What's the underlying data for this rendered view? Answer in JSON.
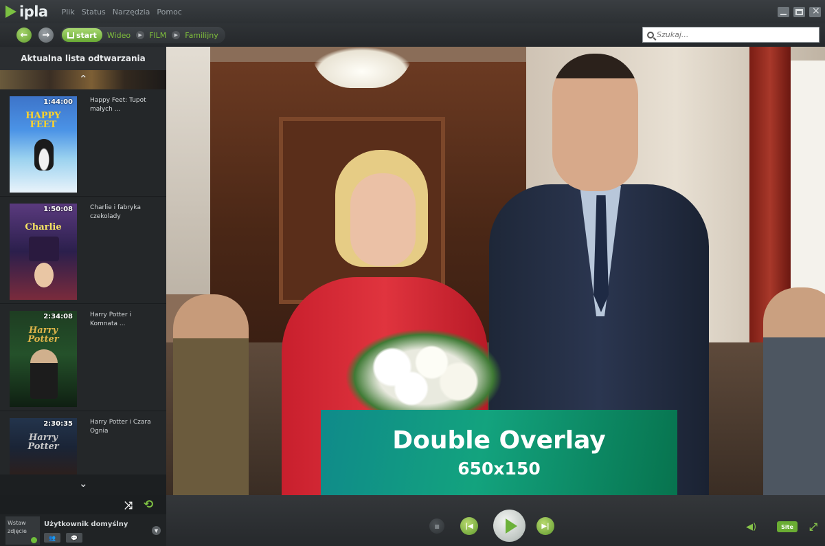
{
  "app": {
    "name": "ipla"
  },
  "menu": [
    "Plik",
    "Status",
    "Narzędzia",
    "Pomoc"
  ],
  "nav": {
    "start_label": "start",
    "breadcrumbs": [
      "Wideo",
      "FILM",
      "Familijny"
    ]
  },
  "search": {
    "placeholder": "Szukaj..."
  },
  "sidebar": {
    "title": "Aktualna lista odtwarzania",
    "playlist": [
      {
        "duration": "1:44:00",
        "title": "Happy Feet: Tupot małych ...",
        "poster_text": "HAPPY FEET"
      },
      {
        "duration": "1:50:08",
        "title": "Charlie i fabryka czekolady",
        "poster_text": "Charlie"
      },
      {
        "duration": "2:34:08",
        "title": "Harry Potter i Komnata ...",
        "poster_text": "Harry Potter"
      },
      {
        "duration": "2:30:35",
        "title": "Harry Potter i Czara Ognia",
        "poster_text": "Harry Potter"
      }
    ]
  },
  "user": {
    "avatar_label": "Wstaw zdjęcie",
    "name": "Użytkownik domyślny"
  },
  "overlay": {
    "title": "Double Overlay",
    "size": "650x150"
  },
  "controls": {
    "site_label": "Site"
  },
  "colors": {
    "accent": "#7fbf3c",
    "background": "#2a2d30",
    "overlay": "#13a37e"
  }
}
